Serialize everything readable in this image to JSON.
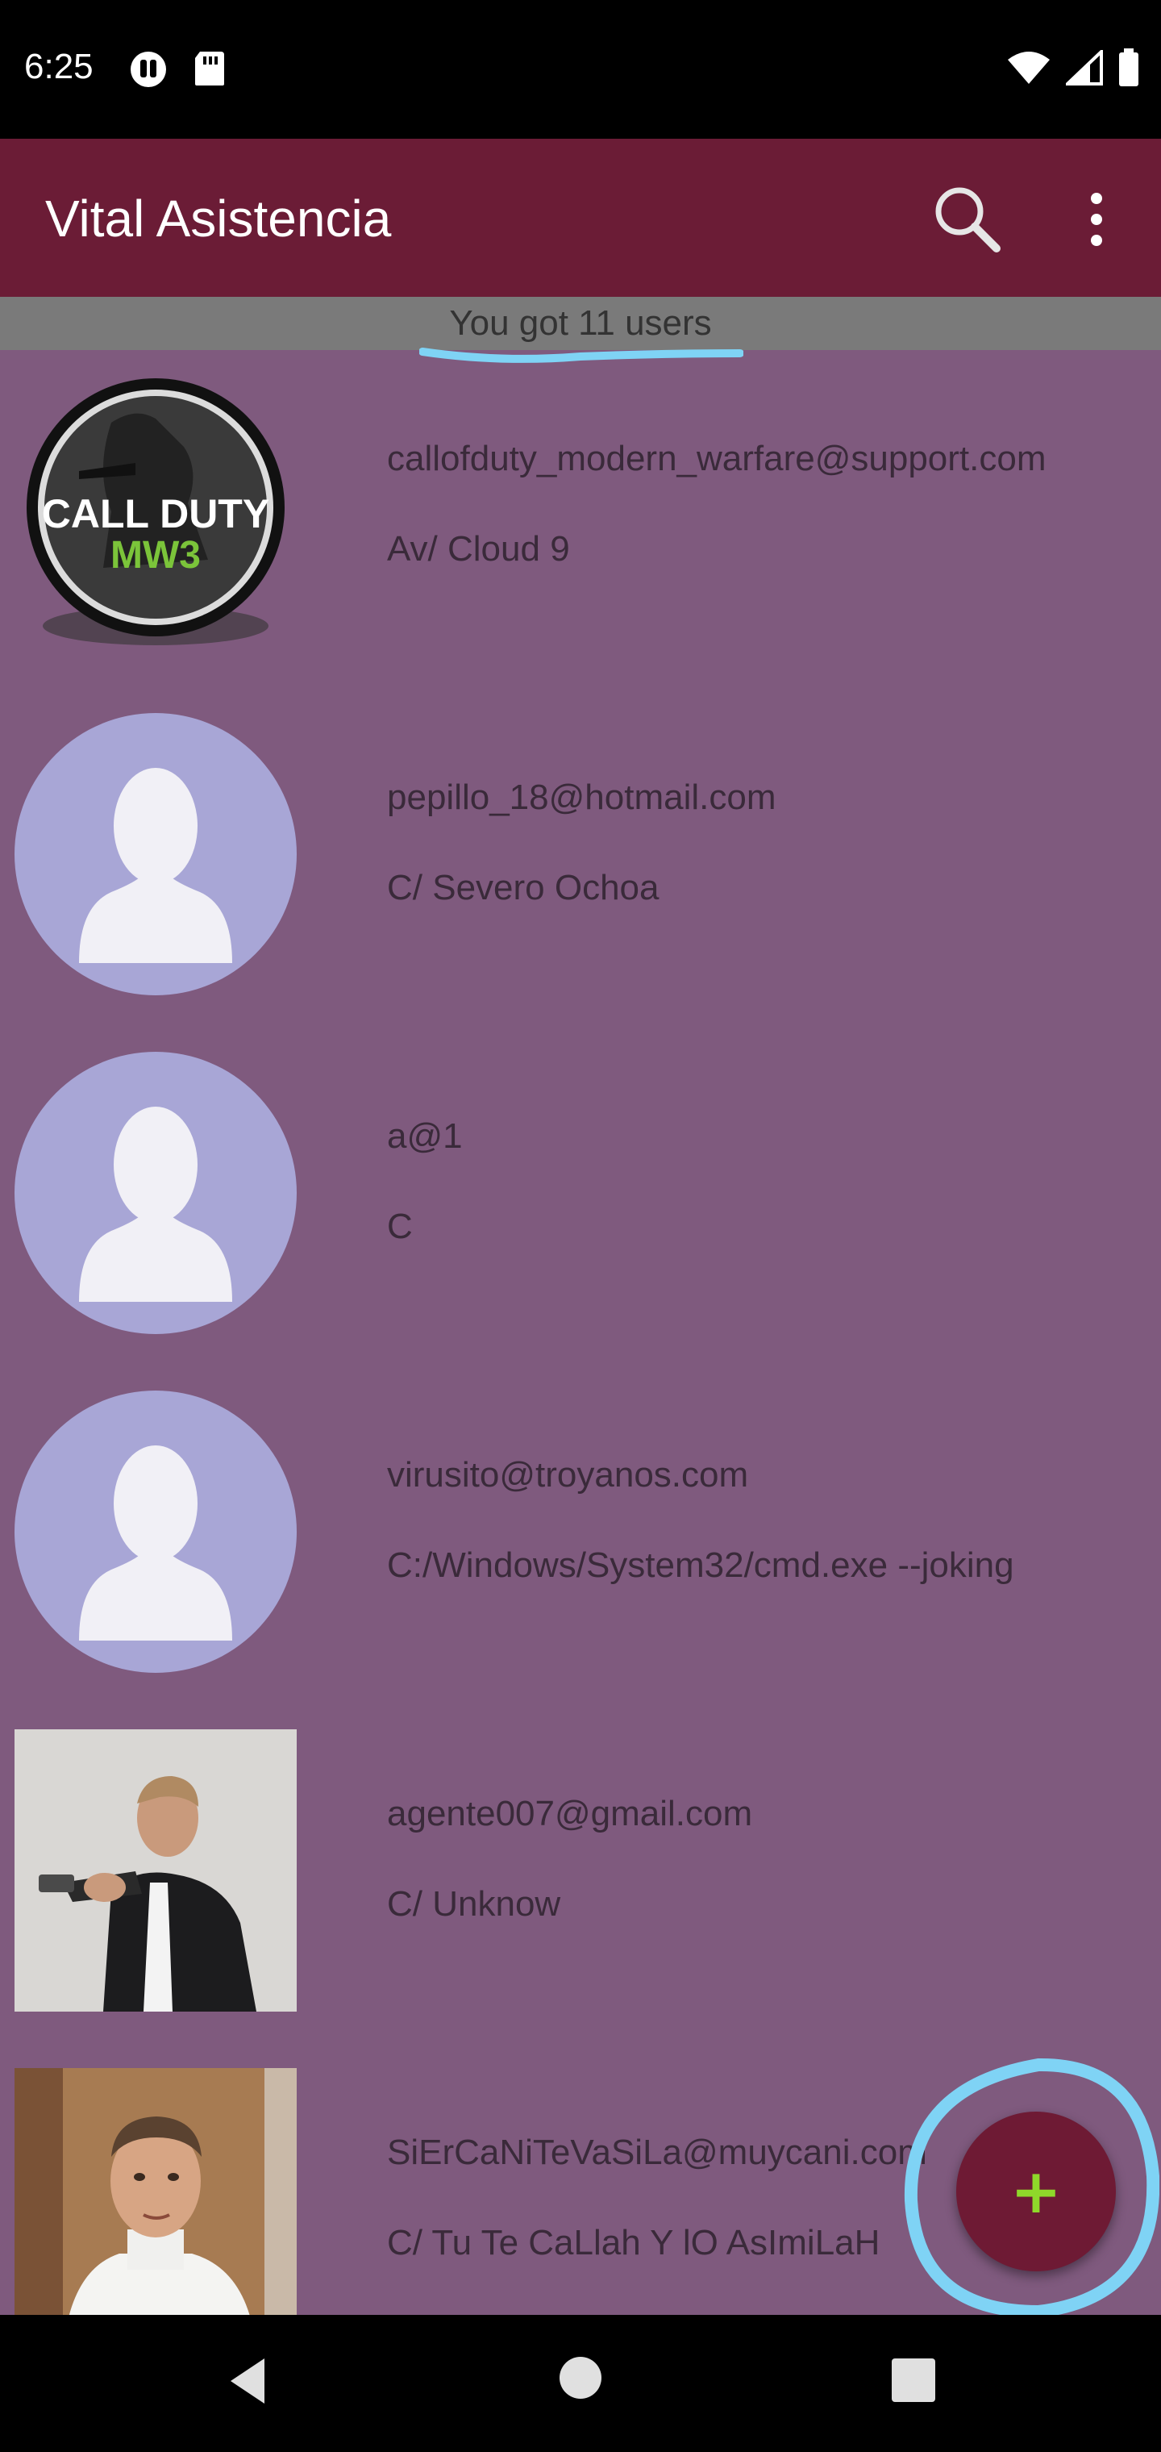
{
  "status_bar": {
    "time": "6:25",
    "left_icons": [
      "media-icon",
      "sd-card-icon"
    ],
    "right_icons": [
      "wifi-icon",
      "signal-icon",
      "battery-icon"
    ]
  },
  "app_bar": {
    "title": "Vital Asistencia",
    "icons": [
      "search-icon",
      "more-vert-icon"
    ],
    "color": "#6b1c36"
  },
  "banner": {
    "text": "You got 11 users"
  },
  "users": [
    {
      "email": "callofduty_modern_warfare@support.com",
      "address": "Av/ Cloud 9",
      "avatar": "cod-mw3-logo",
      "avatar_text": "CALL DUTY MW3"
    },
    {
      "email": "pepillo_18@hotmail.com",
      "address": "C/ Severo Ochoa",
      "avatar": "default-avatar"
    },
    {
      "email": "a@1",
      "address": "C",
      "avatar": "default-avatar"
    },
    {
      "email": "virusito@troyanos.com",
      "address": "C:/Windows/System32/cmd.exe --joking",
      "avatar": "default-avatar"
    },
    {
      "email": "agente007@gmail.com",
      "address": "C/ Unknow",
      "avatar": "photo-agent"
    },
    {
      "email": "SiErCaNiTeVaSiLa@muycani.com",
      "address": "C/ Tu Te CaLlah Y lO AsImiLaH",
      "avatar": "photo-man"
    }
  ],
  "fab": {
    "label": "+",
    "icon": "add-icon"
  },
  "nav_bar": {
    "icons": [
      "back-icon",
      "home-icon",
      "recents-icon"
    ]
  },
  "colors": {
    "list_background": "#7f5a7e",
    "banner_background": "#7a7a7a",
    "avatar_background": "#a8a6d6",
    "fab_background": "#6e1a34",
    "fab_plus": "#8fd82a",
    "annotation_highlight": "#7fd3f5"
  }
}
